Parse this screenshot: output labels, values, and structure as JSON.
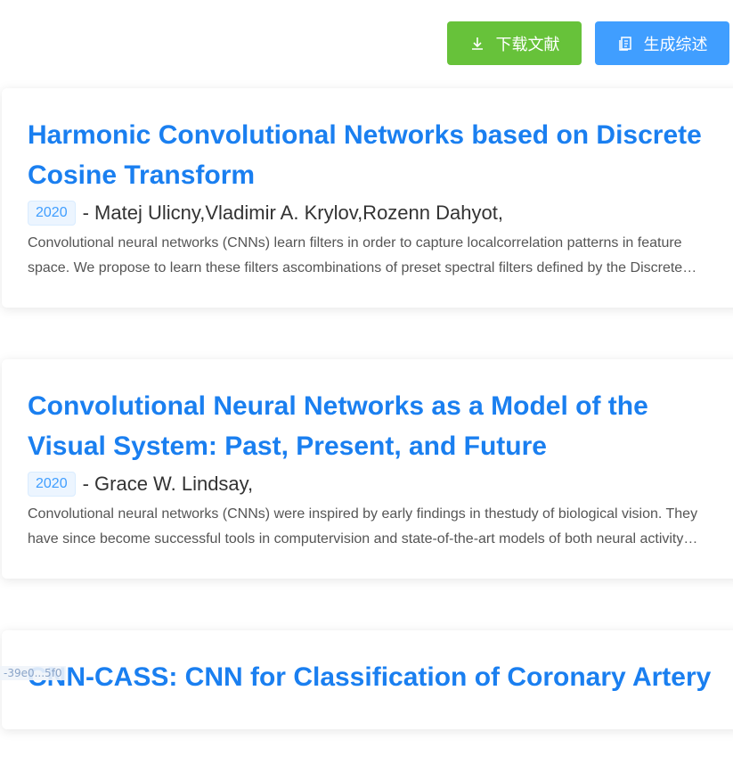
{
  "toolbar": {
    "download_label": "下载文献",
    "summary_label": "生成综述"
  },
  "papers": [
    {
      "title": "Harmonic Convolutional Networks based on Discrete Cosine Transform",
      "year": "2020",
      "authors": "- Matej Ulicny,Vladimir A. Krylov,Rozenn Dahyot,",
      "abstract": "Convolutional neural networks (CNNs) learn filters in order to capture localcorrelation patterns in feature space. We propose to learn these filters ascombinations of preset spectral filters defined by the Discrete Cosine Transform."
    },
    {
      "title": "Convolutional Neural Networks as a Model of the Visual System: Past, Present, and Future",
      "year": "2020",
      "authors": "- Grace W. Lindsay,",
      "abstract": "Convolutional neural networks (CNNs) were inspired by early findings in thestudy of biological vision. They have since become successful tools in computervision and state-of-the-art models of both neural activity and behavior."
    },
    {
      "title": "CNN-CASS: CNN for Classification of Coronary Artery",
      "year": "",
      "authors": "",
      "abstract": ""
    }
  ],
  "status_tip": "-39e0...5f0"
}
